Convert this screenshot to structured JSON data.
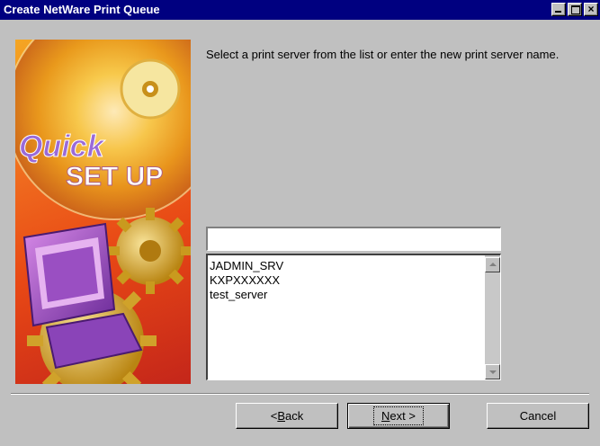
{
  "window": {
    "title": "Create NetWare Print Queue",
    "controls": {
      "minimize": "minimize",
      "maximize": "maximize",
      "close": "×"
    }
  },
  "banner": {
    "line1": "Quick",
    "line2": "SET UP"
  },
  "prompt": "Select a print server from the list or enter the new print server name.",
  "name_input": {
    "value": "",
    "placeholder": ""
  },
  "server_list": {
    "items": [
      "JADMIN_SRV",
      "KXPXXXXXX",
      "test_server"
    ]
  },
  "buttons": {
    "back_prefix": "< ",
    "back_accel": "B",
    "back_rest": "ack",
    "next_accel": "N",
    "next_rest": "ext >",
    "cancel": "Cancel"
  },
  "colors": {
    "titlebar": "#000080",
    "dialog": "#c0c0c0",
    "banner_orange": "#ef6a1e",
    "banner_purple": "#7a3aa8"
  }
}
